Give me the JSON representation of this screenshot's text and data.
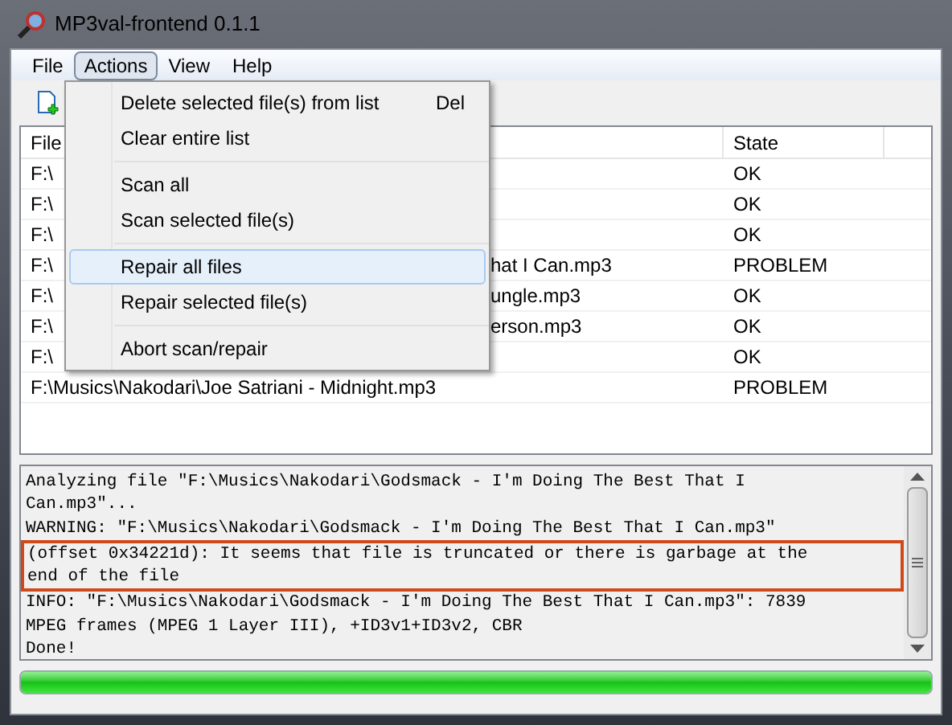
{
  "window": {
    "title": "MP3val-frontend 0.1.1"
  },
  "menu_bar": [
    {
      "label": "File",
      "selected": false
    },
    {
      "label": "Actions",
      "selected": true
    },
    {
      "label": "View",
      "selected": false
    },
    {
      "label": "Help",
      "selected": false
    }
  ],
  "dropdown": {
    "items": [
      {
        "kind": "item",
        "label": "Delete selected file(s) from list",
        "shortcut": "Del",
        "highlighted": false
      },
      {
        "kind": "item",
        "label": "Clear entire list",
        "highlighted": false
      },
      {
        "kind": "separator"
      },
      {
        "kind": "item",
        "label": "Scan all",
        "highlighted": false
      },
      {
        "kind": "item",
        "label": "Scan selected file(s)",
        "highlighted": false
      },
      {
        "kind": "separator"
      },
      {
        "kind": "item",
        "label": "Repair all files",
        "highlighted": true
      },
      {
        "kind": "item",
        "label": "Repair selected file(s)",
        "highlighted": false
      },
      {
        "kind": "separator"
      },
      {
        "kind": "item",
        "label": "Abort scan/repair",
        "highlighted": false
      }
    ]
  },
  "table": {
    "columns": [
      "File",
      "State"
    ],
    "rows": [
      {
        "file_start": "F:\\",
        "state": "OK"
      },
      {
        "file_start": "F:\\",
        "state": "OK"
      },
      {
        "file_start": "F:\\",
        "state": "OK"
      },
      {
        "file_start": "F:\\",
        "file_end": "hat I Can.mp3",
        "state": "PROBLEM"
      },
      {
        "file_start": "F:\\",
        "file_end": "ungle.mp3",
        "state": "OK"
      },
      {
        "file_start": "F:\\",
        "file_end": "erson.mp3",
        "state": "OK"
      },
      {
        "file_start": "F:\\",
        "state": "OK"
      },
      {
        "file_start": "F:\\Musics\\Nakodari\\Joe Satriani - Midnight.mp3",
        "state": "PROBLEM"
      }
    ]
  },
  "log": {
    "lines": [
      {
        "text": "Analyzing file \"F:\\Musics\\Nakodari\\Godsmack - I'm Doing The Best That I",
        "highlighted": false
      },
      {
        "text": "Can.mp3\"...",
        "highlighted": false
      },
      {
        "text": "WARNING: \"F:\\Musics\\Nakodari\\Godsmack - I'm Doing The Best That I Can.mp3\"",
        "highlighted": false
      },
      {
        "text": "(offset 0x34221d): It seems that file is truncated or there is garbage at the",
        "highlighted": true
      },
      {
        "text": "end of the file",
        "highlighted": true
      },
      {
        "text": "INFO: \"F:\\Musics\\Nakodari\\Godsmack - I'm Doing The Best That I Can.mp3\": 7839",
        "highlighted": false
      },
      {
        "text": "MPEG frames (MPEG 1 Layer III), +ID3v1+ID3v2, CBR",
        "highlighted": false
      },
      {
        "text": "Done!",
        "highlighted": false
      }
    ]
  },
  "progress": {
    "level": 1
  }
}
